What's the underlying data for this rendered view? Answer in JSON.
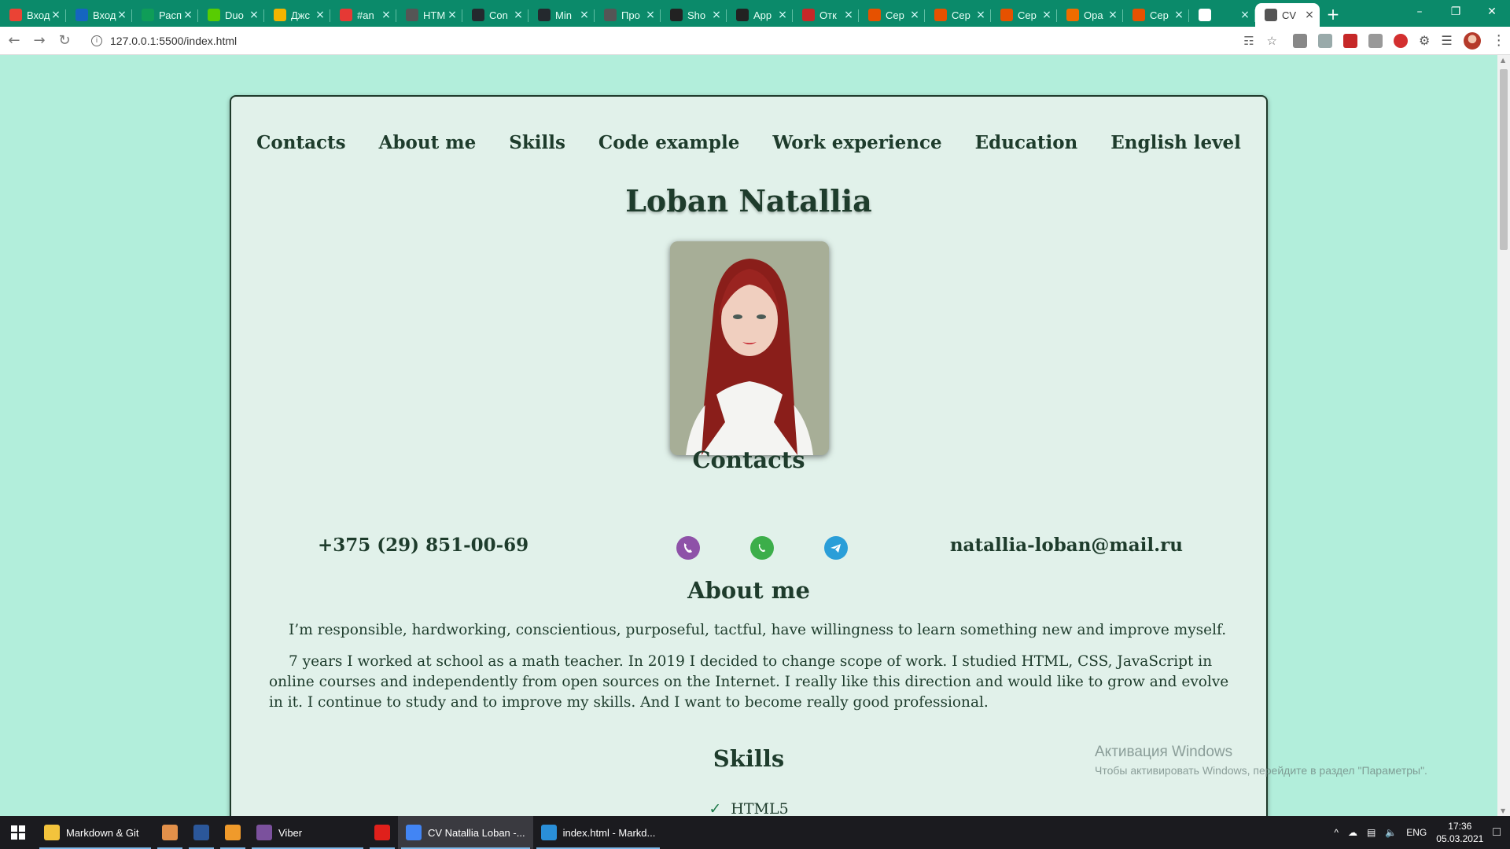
{
  "browser": {
    "tabs": [
      {
        "label": "Вход",
        "favicon": "gmail-icon",
        "color": "#ea4335"
      },
      {
        "label": "Вход",
        "favicon": "mail-icon",
        "color": "#1565c0"
      },
      {
        "label": "Расп",
        "favicon": "schedule-icon",
        "color": "#0f9d58"
      },
      {
        "label": "Duo",
        "favicon": "duolingo-icon",
        "color": "#58cc02"
      },
      {
        "label": "Джс",
        "favicon": "course-icon",
        "color": "#f4b400"
      },
      {
        "label": "#an",
        "favicon": "youtube-icon",
        "color": "#e53935"
      },
      {
        "label": "HTM",
        "favicon": "web-icon",
        "color": "#555555"
      },
      {
        "label": "Con",
        "favicon": "github-icon",
        "color": "#24292e"
      },
      {
        "label": "Min",
        "favicon": "github-icon",
        "color": "#24292e"
      },
      {
        "label": "Про",
        "favicon": "web-icon",
        "color": "#555555"
      },
      {
        "label": "Sho",
        "favicon": "shop-icon",
        "color": "#222222"
      },
      {
        "label": "App",
        "favicon": "rs-icon",
        "color": "#222222"
      },
      {
        "label": "Отк",
        "favicon": "r-icon",
        "color": "#c62828"
      },
      {
        "label": "Сер",
        "favicon": "flame-icon",
        "color": "#e65100"
      },
      {
        "label": "Сер",
        "favicon": "flame-icon",
        "color": "#e65100"
      },
      {
        "label": "Сер",
        "favicon": "flame-icon",
        "color": "#e65100"
      },
      {
        "label": "Ора",
        "favicon": "cookie-icon",
        "color": "#ef6c00"
      },
      {
        "label": "Сер",
        "favicon": "flame-icon",
        "color": "#e65100"
      },
      {
        "label": "",
        "favicon": "play-icon",
        "color": "#ffffff"
      },
      {
        "label": "CV",
        "favicon": "globe-icon",
        "color": "#555555"
      }
    ],
    "url": "127.0.0.1:5500/index.html"
  },
  "page": {
    "nav": [
      "Contacts",
      "About me",
      "Skills",
      "Code example",
      "Work experience",
      "Education",
      "English level"
    ],
    "name": "Loban Natallia",
    "contacts_heading": "Contacts",
    "phone": "+375 (29) 851-00-69",
    "email": "natallia-loban@mail.ru",
    "social": [
      {
        "icon": "viber-icon",
        "color": "#8e52a8"
      },
      {
        "icon": "whatsapp-icon",
        "color": "#3cae4a"
      },
      {
        "icon": "telegram-icon",
        "color": "#2a9ed8"
      }
    ],
    "about_heading": "About me",
    "about_p1": "I’m responsible, hardworking, conscientious, purposeful, tactful, have willingness to learn something new and improve myself.",
    "about_p2": "7 years I worked at school as a math teacher. In 2019 I decided to change scope of work. I studied HTML, CSS, JavaScript in online courses and independently from open sources on the Internet. I really like this direction and would like to grow and evolve in it. I continue to study and to improve my skills. And I want to become really good professional.",
    "skills_heading": "Skills",
    "skills": [
      "HTML5"
    ],
    "accent": "#1e3c2c",
    "background": "#b2eedb",
    "card_background": "#e1f1ea"
  },
  "watermark": {
    "line1": "Активация Windows",
    "line2": "Чтобы активировать Windows, перейдите в раздел \"Параметры\"."
  },
  "taskbar": {
    "items": [
      {
        "label": "Markdown & Git",
        "icon": "folder-icon",
        "color": "#f3c33c"
      },
      {
        "label": "",
        "icon": "media-player-icon",
        "color": "#e2904a"
      },
      {
        "label": "",
        "icon": "word-icon",
        "color": "#2b579a"
      },
      {
        "label": "",
        "icon": "sublime-icon",
        "color": "#f09a2b"
      },
      {
        "label": "Viber",
        "icon": "viber-icon",
        "color": "#7b519d"
      },
      {
        "label": "",
        "icon": "opera-icon",
        "color": "#e0201b"
      },
      {
        "label": "CV Natallia Loban -...",
        "icon": "chrome-icon",
        "color": "#4285f4"
      },
      {
        "label": "index.html - Markd...",
        "icon": "vscode-icon",
        "color": "#2a8fd8"
      }
    ],
    "lang": "ENG",
    "time": "17:36",
    "date": "05.03.2021"
  }
}
